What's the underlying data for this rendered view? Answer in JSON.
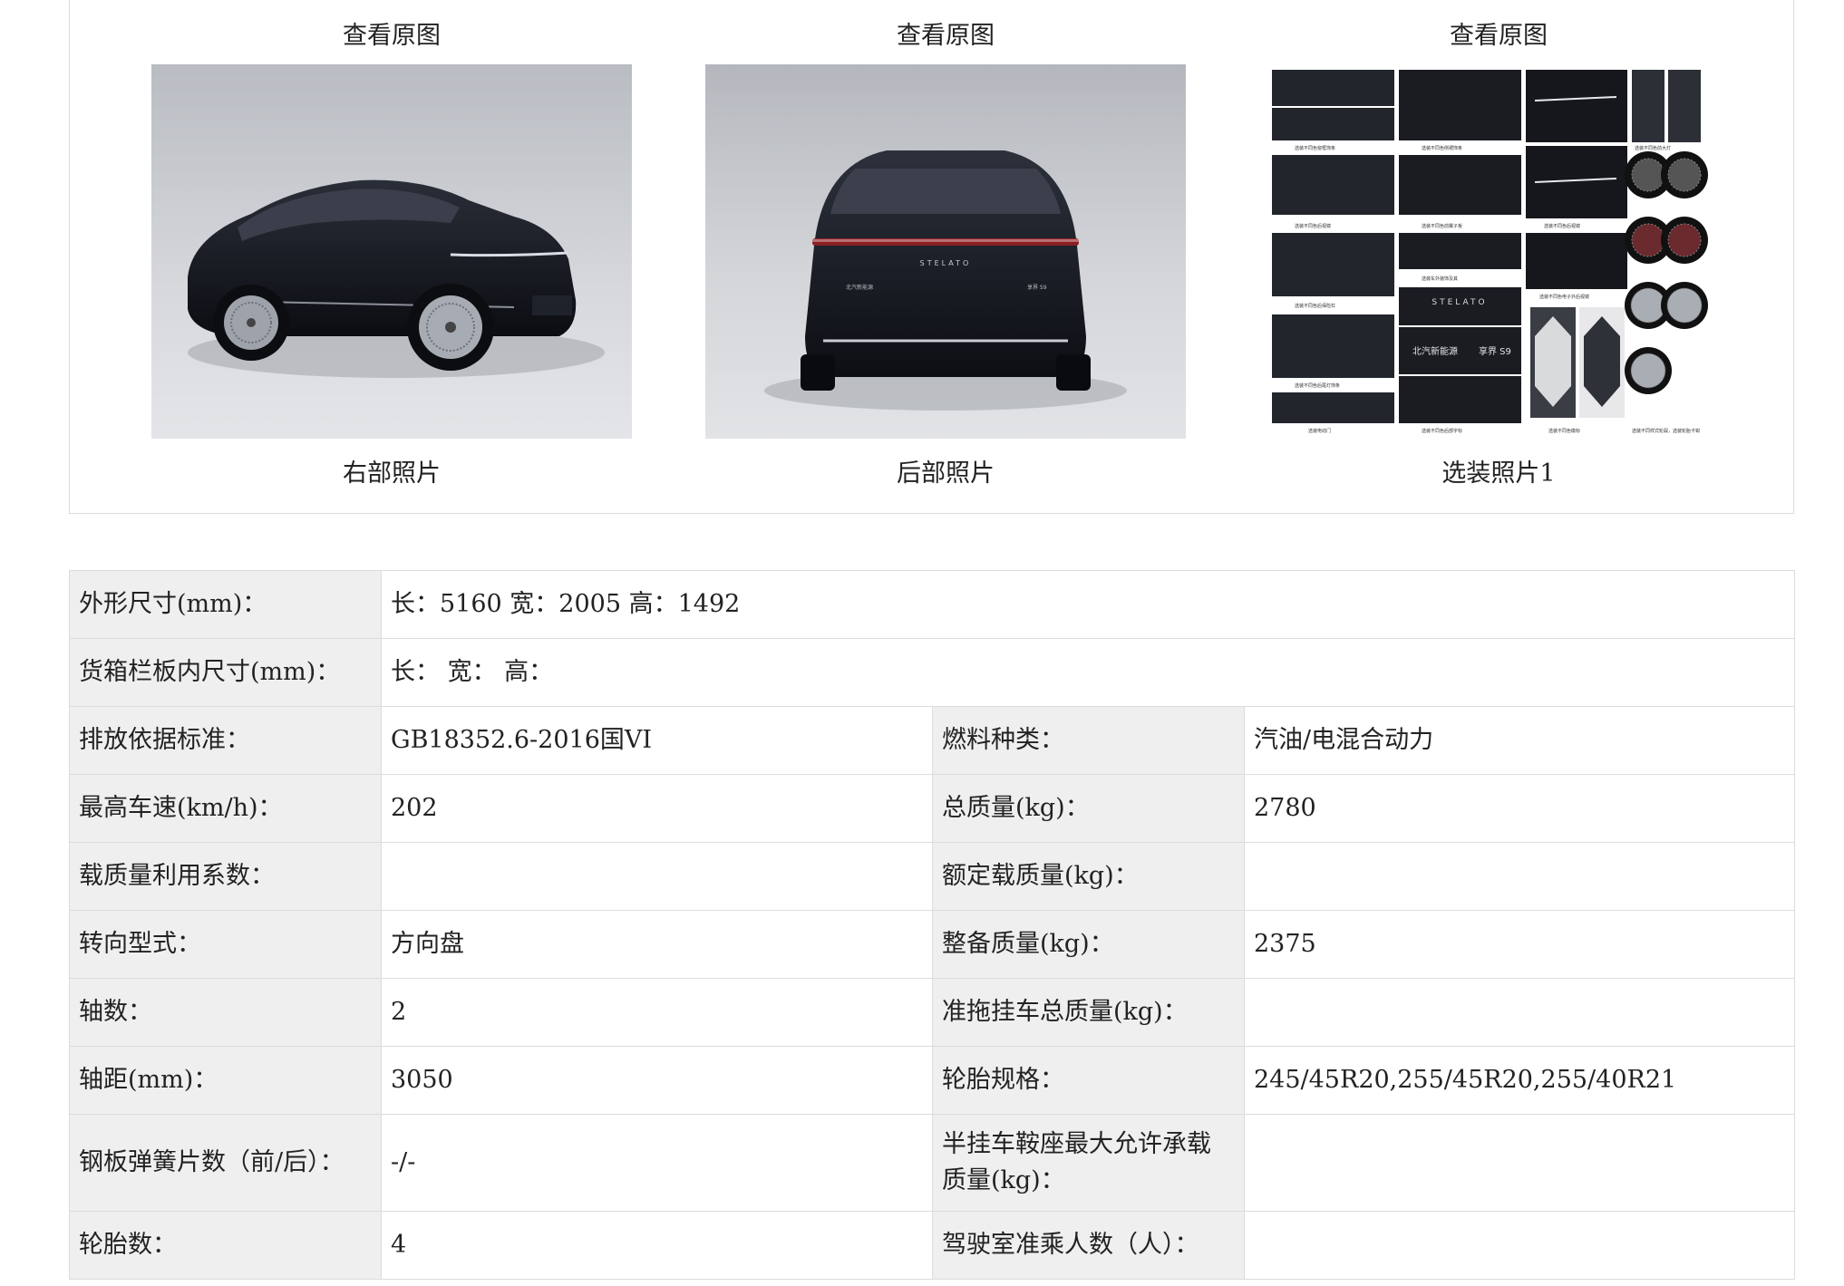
{
  "gallery": {
    "view_label": "查看原图",
    "photos": [
      {
        "caption": "右部照片",
        "kind": "right-side"
      },
      {
        "caption": "后部照片",
        "kind": "rear"
      },
      {
        "caption": "选装照片1",
        "kind": "optional-collage"
      }
    ],
    "rear_badges": {
      "brand": "STELATO",
      "left": "北汽新能源",
      "right": "享界 S9"
    },
    "collage_captions": [
      "选装不同色窗框饰条",
      "选装不同色侧裙饰条",
      "选装不同色前大灯",
      "选装不同色后视镜",
      "选装不同色前翼子板",
      "选装不同色后视镜",
      "选装不同色后保险杠",
      "选装车外装饰及其",
      "选装不同色电子外后视镜",
      "选装不同色后尾灯饰条",
      "选装电动门",
      "选装不同色后部字标",
      "选装不同色徽标",
      "选装不同样式轮毂，选装轮胎卡钳"
    ],
    "collage_text": {
      "stelato": "STELATO",
      "brand_cn": "北汽新能源",
      "model": "享界 S9"
    }
  },
  "specs": {
    "rows": [
      {
        "type": "full",
        "label": "外形尺寸(mm)：",
        "value": "长：5160 宽：2005 高：1492"
      },
      {
        "type": "full",
        "label": "货箱栏板内尺寸(mm)：",
        "value": "长：  宽：  高："
      },
      {
        "type": "pair",
        "label1": "排放依据标准：",
        "value1": "GB18352.6-2016国VI",
        "label2": "燃料种类：",
        "value2": "汽油/电混合动力"
      },
      {
        "type": "pair",
        "label1": "最高车速(km/h)：",
        "value1": "202",
        "label2": "总质量(kg)：",
        "value2": "2780"
      },
      {
        "type": "pair",
        "label1": "载质量利用系数：",
        "value1": "",
        "label2": "额定载质量(kg)：",
        "value2": ""
      },
      {
        "type": "pair",
        "label1": "转向型式：",
        "value1": "方向盘",
        "label2": "整备质量(kg)：",
        "value2": "2375"
      },
      {
        "type": "pair",
        "label1": "轴数：",
        "value1": "2",
        "label2": "准拖挂车总质量(kg)：",
        "value2": ""
      },
      {
        "type": "pair",
        "label1": "轴距(mm)：",
        "value1": "3050",
        "label2": "轮胎规格：",
        "value2": "245/45R20,255/45R20,255/40R21"
      },
      {
        "type": "pair",
        "label1": "钢板弹簧片数（前/后）：",
        "value1": "-/-",
        "label2": "半挂车鞍座最大允许承载质量(kg)：",
        "value2": ""
      },
      {
        "type": "pair",
        "label1": "轮胎数：",
        "value1": "4",
        "label2": "驾驶室准乘人数（人）：",
        "value2": ""
      }
    ]
  },
  "colors": {
    "label_bg": "#efefef",
    "border": "#dcdcdc",
    "car_body": "#151820",
    "studio_bg": "#c9ccd1"
  }
}
